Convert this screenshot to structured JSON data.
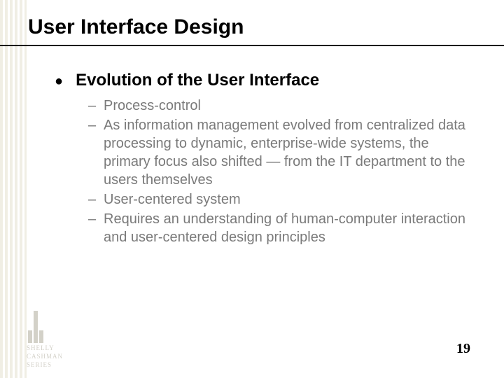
{
  "title": "User Interface Design",
  "bullet": {
    "marker": "●",
    "text": "Evolution of the User Interface"
  },
  "subitems": [
    "Process-control",
    "As information management evolved from centralized data processing to dynamic, enterprise-wide systems, the primary focus also shifted — from the IT department to the users themselves",
    "User-centered system",
    "Requires an understanding of human-computer interaction and user-centered design principles"
  ],
  "dash": "–",
  "page_number": "19",
  "logo": {
    "line1": "SHELLY",
    "line2": "CASHMAN",
    "line3": "SERIES"
  }
}
